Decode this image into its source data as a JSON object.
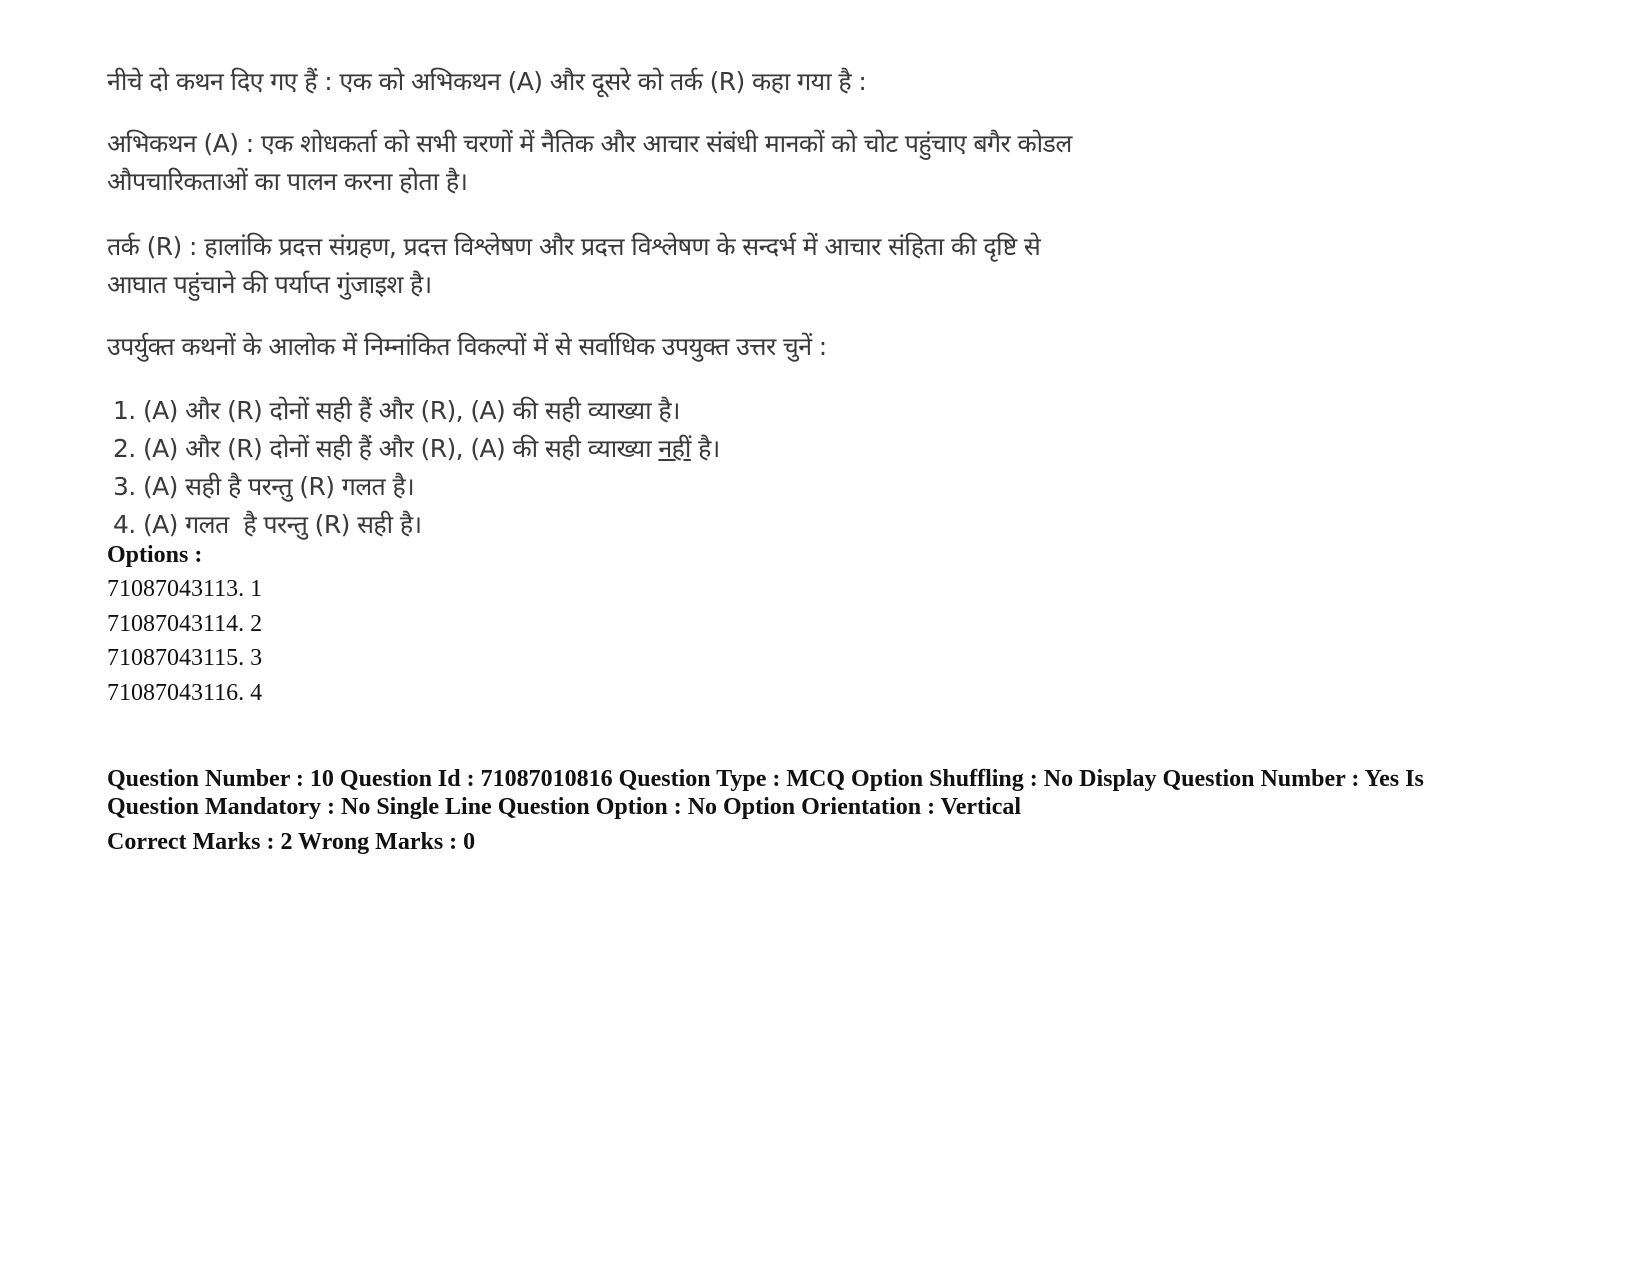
{
  "question": {
    "intro": "नीचे दो कथन दिए गए हैं : एक को अभिकथन (A) और दूसरे को तर्क (R) कहा गया है :",
    "assertion_line1": "अभिकथन (A) : एक शोधकर्ता को सभी चरणों में नैतिक और आचार संबंधी मानकों को चोट पहुंचाए बगैर कोडल",
    "assertion_line2": "औपचारिकताओं का पालन करना होता है।",
    "reason_line1": "तर्क (R) : हालांकि प्रदत्त संग्रहण, प्रदत्त विश्लेषण और प्रदत्त विश्लेषण के सन्दर्भ में आचार संहिता की दृष्टि से",
    "reason_line2": "आघात पहुंचाने की पर्याप्त गुंजाइश है।",
    "prompt": "उपर्युक्त कथनों के आलोक में निम्नांकित विकल्पों में से सर्वाधिक उपयुक्त उत्तर चुनें :",
    "choices": [
      {
        "num": "1.",
        "text": "(A) और (R) दोनों सही हैं और (R), (A) की सही व्याख्या है।"
      },
      {
        "num": "2.",
        "text_before": "(A) और (R) दोनों सही हैं और (R), (A) की सही व्याख्या ",
        "underlined": "नहीं",
        "text_after": " है।"
      },
      {
        "num": "3.",
        "text": "(A) सही है परन्तु (R) गलत है।"
      },
      {
        "num": "4.",
        "text": "(A) गलत  है परन्तु (R) सही है।"
      }
    ]
  },
  "options": {
    "label": "Options :",
    "items": [
      "71087043113. 1",
      "71087043114. 2",
      "71087043115. 3",
      "71087043116. 4"
    ]
  },
  "meta": {
    "line1": "Question Number : 10 Question Id : 71087010816 Question Type : MCQ Option Shuffling : No Display Question Number : Yes Is",
    "line2": "Question Mandatory : No Single Line Question Option : No Option Orientation : Vertical",
    "marks": "Correct Marks : 2 Wrong Marks : 0"
  }
}
